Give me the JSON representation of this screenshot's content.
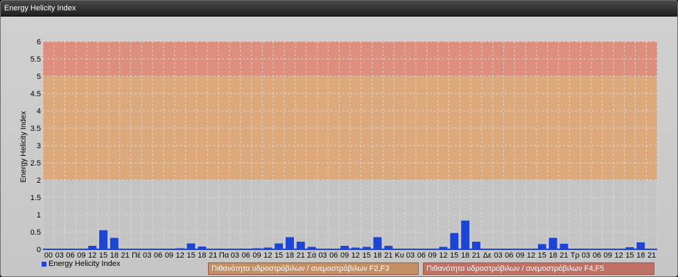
{
  "window": {
    "title": "Energy Helicity Index"
  },
  "legend": {
    "series_label": "Energy Helicity Index"
  },
  "bands": [
    {
      "label": "Πιθανότητα υδροστρόβιλων / ανεμοστρόβιλων F2,F3",
      "from": 2,
      "to": 5,
      "color": "#e2a46f"
    },
    {
      "label": "Πιθανότητα υδροστρόβιλων / ανεμοστρόβιλων F4,F5",
      "from": 5,
      "to": 6,
      "color": "#e28570"
    }
  ],
  "colors": {
    "bar": "#1a45d6",
    "grid": "#e6e6e6",
    "baseline": "#1a45d6"
  },
  "chart_data": {
    "type": "bar",
    "title": "Energy Helicity Index",
    "ylabel": "Energy Helicity Index",
    "xlabel": "",
    "ylim": [
      0,
      6
    ],
    "yticks": [
      "0",
      "0.5",
      "1",
      "1.5",
      "2",
      "2.5",
      "3",
      "3.5",
      "4",
      "4.5",
      "5",
      "5.5",
      "6"
    ],
    "categories": [
      "00",
      "03",
      "06",
      "09",
      "12",
      "15",
      "18",
      "21",
      "Πέ",
      "03",
      "06",
      "09",
      "12",
      "15",
      "18",
      "21",
      "Πα",
      "03",
      "06",
      "09",
      "12",
      "15",
      "18",
      "21",
      "Σά",
      "03",
      "06",
      "09",
      "12",
      "15",
      "18",
      "21",
      "Κυ",
      "03",
      "06",
      "09",
      "12",
      "15",
      "18",
      "21",
      "Δε",
      "03",
      "06",
      "09",
      "12",
      "15",
      "18",
      "21",
      "Τρ",
      "03",
      "06",
      "09",
      "12",
      "15",
      "18",
      "21"
    ],
    "series": [
      {
        "name": "Energy Helicity Index",
        "values": [
          0.02,
          0.01,
          0.01,
          0.01,
          0.1,
          0.55,
          0.33,
          0.01,
          0.01,
          0.01,
          0.01,
          0.01,
          0.03,
          0.17,
          0.08,
          0.01,
          0.01,
          0.01,
          0.01,
          0.03,
          0.05,
          0.17,
          0.35,
          0.22,
          0.07,
          0.01,
          0.01,
          0.1,
          0.05,
          0.07,
          0.35,
          0.1,
          0.01,
          0.02,
          0.01,
          0.01,
          0.07,
          0.47,
          0.83,
          0.22,
          0.01,
          0.01,
          0.01,
          0.01,
          0.01,
          0.15,
          0.33,
          0.16,
          0.01,
          0.01,
          0.01,
          0.01,
          0.02,
          0.06,
          0.2,
          0.02
        ]
      }
    ],
    "grid": true,
    "legend": "bottom-left"
  }
}
